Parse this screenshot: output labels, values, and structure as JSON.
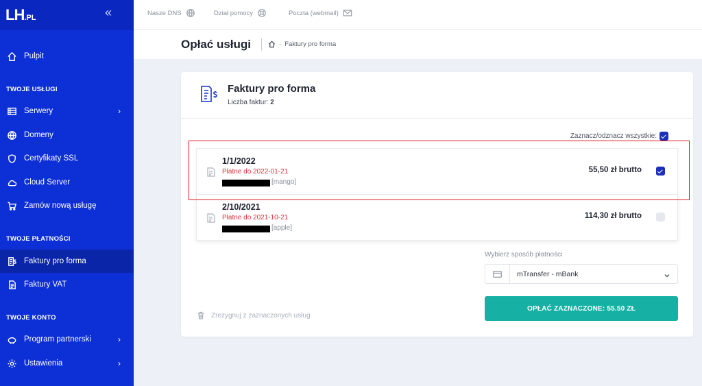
{
  "brand": {
    "logo_main": "LH",
    "logo_suffix": ".PL"
  },
  "sidebar": {
    "dashboard": "Pulpit",
    "section_services": "TWOJE USŁUGI",
    "servers": "Serwery",
    "domains": "Domeny",
    "ssl": "Certyfikaty SSL",
    "cloud": "Cloud Server",
    "order": "Zamów nową usługę",
    "section_payments": "TWOJE PŁATNOŚCI",
    "proforma": "Faktury pro forma",
    "vat": "Faktury VAT",
    "section_account": "TWOJE KONTO",
    "partner": "Program partnerski",
    "settings": "Ustawienia"
  },
  "topbar": {
    "dns": "Nasze DNS",
    "help": "Dział pomocy",
    "mail": "Poczta (webmail)"
  },
  "header": {
    "title": "Opłać usługi",
    "breadcrumb_current": "Faktury pro forma"
  },
  "card": {
    "title": "Faktury pro forma",
    "count_label": "Liczba faktur:",
    "count_value": "2",
    "select_all": "Zaznacz/odznacz wszystkie:"
  },
  "invoices": [
    {
      "date": "1/1/2022",
      "due": "Płatne do 2022-01-21",
      "tag": "[mango]",
      "amount": "55,50 zł brutto",
      "checked": true
    },
    {
      "date": "2/10/2021",
      "due": "Płatne do 2021-10-21",
      "tag": "[apple]",
      "amount": "114,30 zł brutto",
      "checked": false
    }
  ],
  "payment": {
    "label": "Wybierz sposób płatności",
    "method": "mTransfer - mBank",
    "button": "OPŁAĆ ZAZNACZONE: 55.50 ZŁ",
    "resign": "Zrezygnuj z zaznaczonych usług"
  },
  "colors": {
    "sidebar": "#0d2fd6",
    "accent": "#16b1a4",
    "due": "#e0323b",
    "highlight": "#e3141b"
  }
}
